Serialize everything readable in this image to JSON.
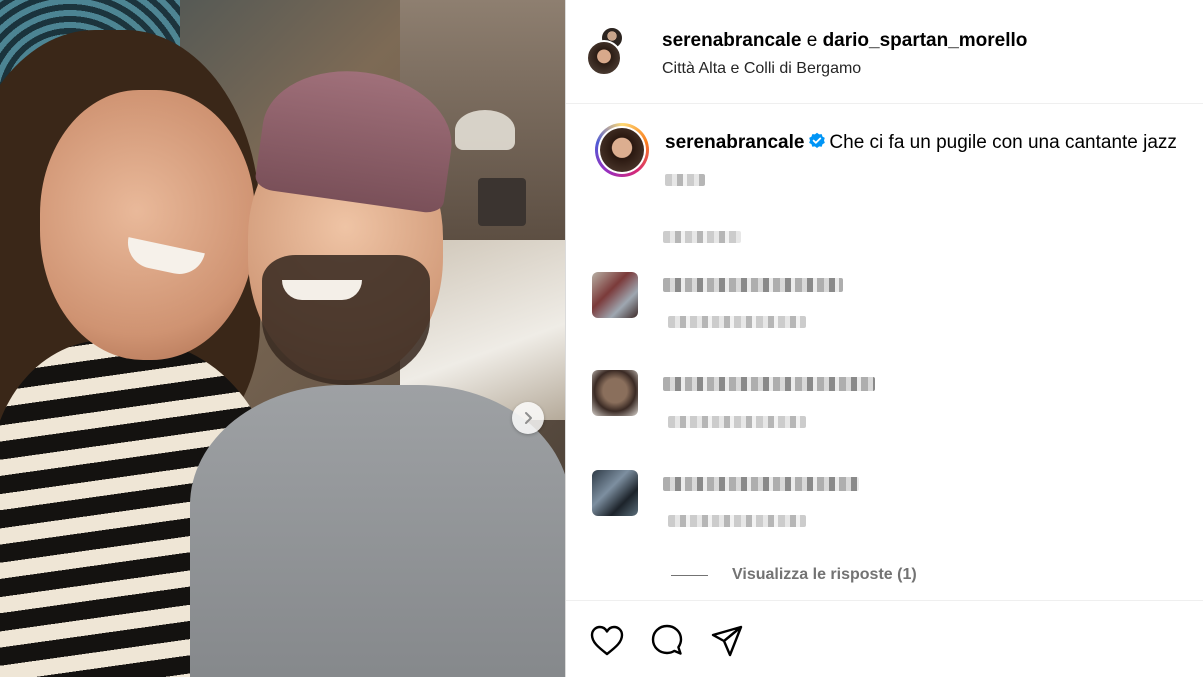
{
  "post": {
    "photo_alt_icon": "carousel-next-icon",
    "header": {
      "author1": "serenabrancale",
      "connector": "e",
      "author2": "dario_spartan_morello",
      "location": "Città Alta e Colli di Bergamo"
    },
    "caption": {
      "username": "serenabrancale",
      "verified_icon": "verified-badge-icon",
      "text": "Che ci fa un pugile con una cantante jazz"
    },
    "comments": [
      {
        "avatar": "blurred-avatar"
      },
      {
        "avatar": "blurred-avatar"
      },
      {
        "avatar": "blurred-avatar"
      }
    ],
    "view_replies": "Visualizza le risposte (1)",
    "actions": {
      "like_icon": "heart-icon",
      "comment_icon": "comment-icon",
      "share_icon": "send-icon"
    }
  },
  "colors": {
    "verified": "#0095f6",
    "muted_text": "#737373",
    "divider": "#efefef"
  }
}
